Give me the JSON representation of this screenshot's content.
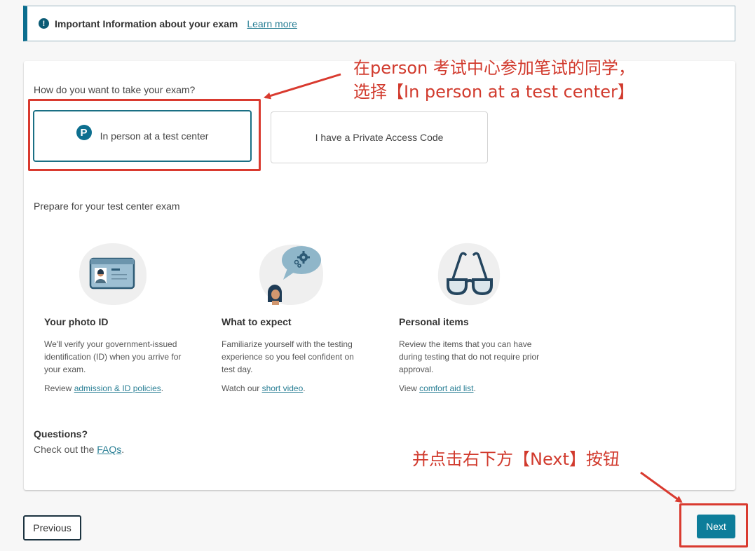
{
  "banner": {
    "icon": "info-circle-icon",
    "text": "Important Information about your exam",
    "link": "Learn more"
  },
  "question": "How do you want to take your exam?",
  "options": [
    {
      "label": "In person at a test center",
      "icon": "pearson-logo-icon",
      "selected": true,
      "logo_glyph": "P"
    },
    {
      "label": "I have a Private Access Code",
      "selected": false
    }
  ],
  "prepare": {
    "title": "Prepare for your test center exam",
    "items": [
      {
        "icon": "photo-id-card-icon",
        "title": "Your photo ID",
        "description": "We'll verify your government-issued identification (ID) when you arrive for your exam.",
        "action_prefix": "Review ",
        "action_link": "admission & ID policies",
        "action_suffix": "."
      },
      {
        "icon": "speech-bubble-gears-icon",
        "title": "What to expect",
        "description": "Familiarize yourself with the testing experience so you feel confident on test day.",
        "action_prefix": "Watch our ",
        "action_link": "short video",
        "action_suffix": "."
      },
      {
        "icon": "glasses-icon",
        "title": "Personal items",
        "description": "Review the items that you can have during testing that do not require prior approval.",
        "action_prefix": "View ",
        "action_link": "comfort aid list",
        "action_suffix": "."
      }
    ]
  },
  "questions": {
    "title": "Questions?",
    "prefix": "Check out the ",
    "link": "FAQs",
    "suffix": "."
  },
  "nav": {
    "previous": "Previous",
    "next": "Next"
  },
  "annotations": {
    "line1": "在person 考试中心参加笔试的同学，",
    "line2": "选择【In person at a test center】",
    "line3": "并点击右下方【Next】按钮",
    "color": "#d93a2f"
  },
  "colors": {
    "accent": "#0d7d9a",
    "link": "#2a7f95",
    "banner_bar": "#0b6e8f"
  }
}
